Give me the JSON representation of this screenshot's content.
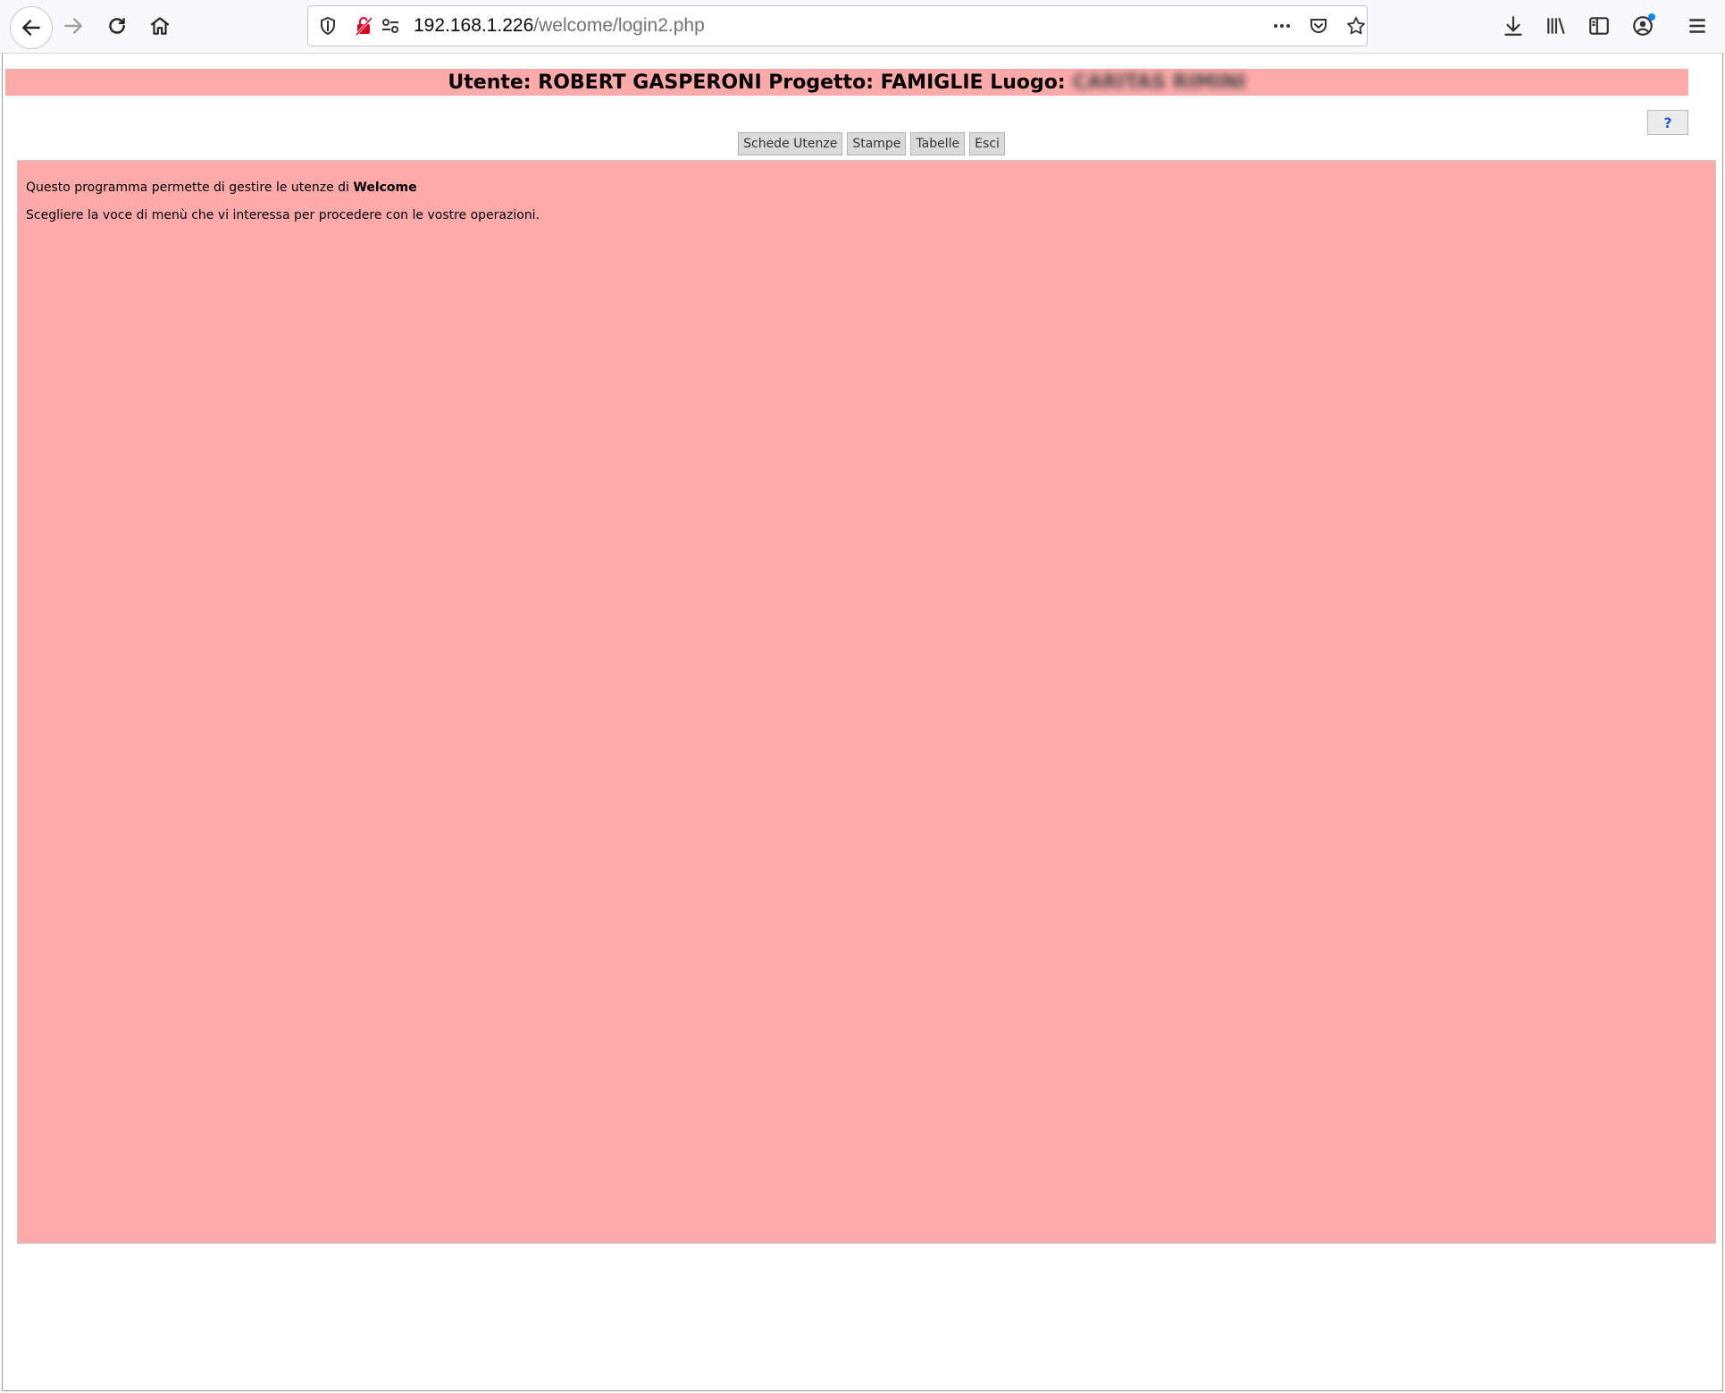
{
  "browser": {
    "url_host": "192.168.1.226",
    "url_path": "/welcome/login2.php",
    "icons": [
      "back-arrow-icon",
      "forward-arrow-icon",
      "reload-icon",
      "home-icon",
      "shield-icon",
      "insecure-lock-icon",
      "permissions-icon",
      "more-icon",
      "pocket-icon",
      "bookmark-star-icon",
      "download-icon",
      "library-icon",
      "sidebar-icon",
      "account-icon",
      "menu-icon"
    ]
  },
  "header": {
    "title": "Utente: ROBERT GASPERONI Progetto: FAMIGLIE Luogo:",
    "location_blurred": "CARITAS RIMINI"
  },
  "help_label": "?",
  "menu": {
    "items": [
      {
        "label": "Schede Utenze"
      },
      {
        "label": "Stampe"
      },
      {
        "label": "Tabelle"
      },
      {
        "label": "Esci"
      }
    ]
  },
  "content": {
    "line1_prefix": "Questo programma permette di gestire le utenze di ",
    "line1_bold": "Welcome",
    "line2": "Scegliere la voce di menù che vi interessa per procedere con le vostre operazioni."
  },
  "colors": {
    "accent": "#ffaaaa"
  }
}
